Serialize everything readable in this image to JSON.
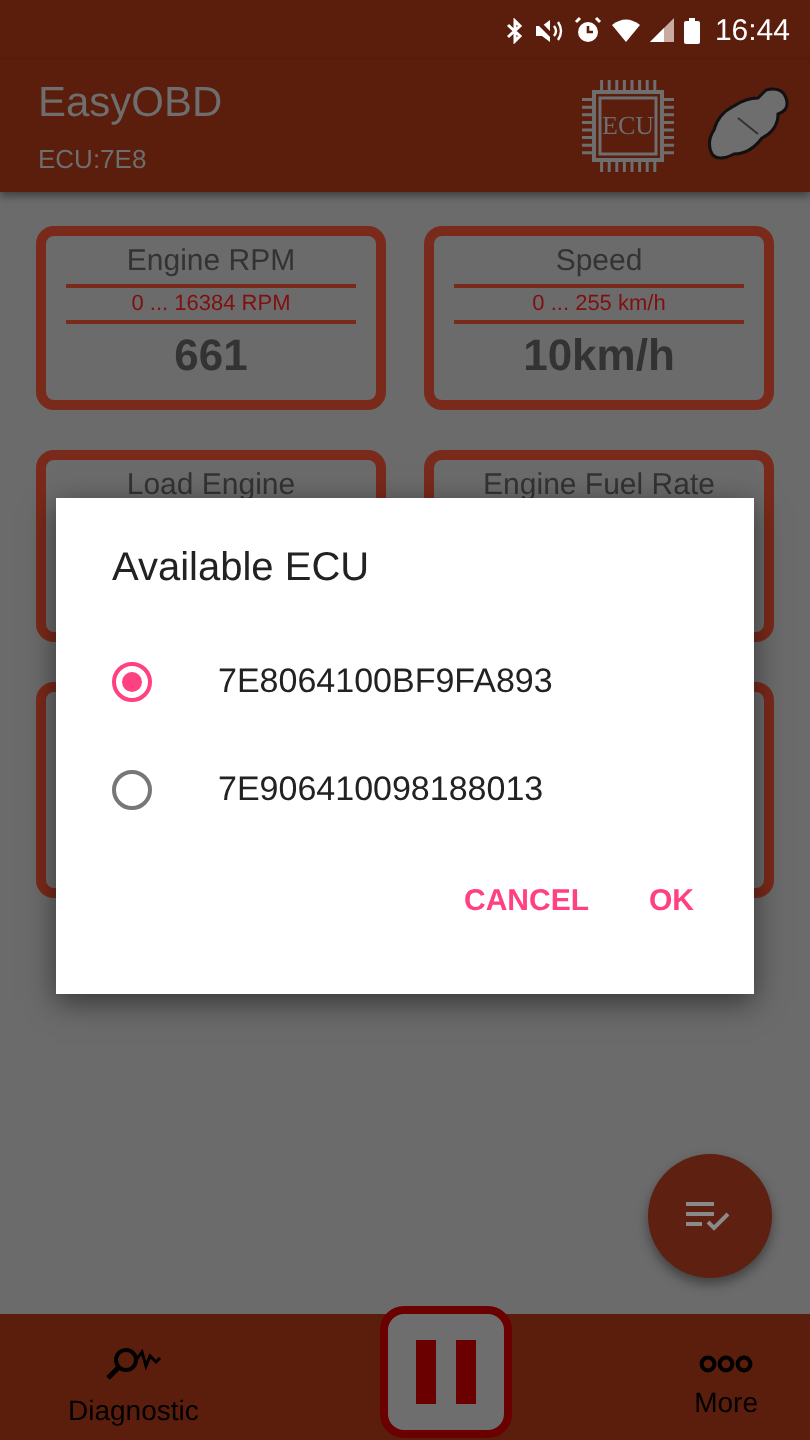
{
  "status_bar": {
    "time": "16:44"
  },
  "app_bar": {
    "title": "EasyOBD",
    "subtitle": "ECU:7E8",
    "chip_label": "ECU"
  },
  "gauges": [
    {
      "kind": "full",
      "title": "Engine RPM",
      "range": "0 ... 16384 RPM",
      "value": "661"
    },
    {
      "kind": "full",
      "title": "Speed",
      "range": "0 ... 255 km/h",
      "value": "10km/h"
    },
    {
      "kind": "covered",
      "title": "Load Engine"
    },
    {
      "kind": "covered",
      "title": "Engine Fuel Rate"
    },
    {
      "kind": "hidden"
    },
    {
      "kind": "hidden"
    }
  ],
  "dialog": {
    "title": "Available ECU",
    "options": [
      {
        "label": "7E8064100BF9FA893",
        "selected": true
      },
      {
        "label": "7E906410098188013",
        "selected": false
      }
    ],
    "buttons": [
      "CANCEL",
      "OK"
    ]
  },
  "bottom_nav": [
    {
      "kind": "diagnostic",
      "label": "Diagnostic"
    },
    {
      "kind": "pause"
    },
    {
      "kind": "more",
      "label": "More"
    }
  ]
}
